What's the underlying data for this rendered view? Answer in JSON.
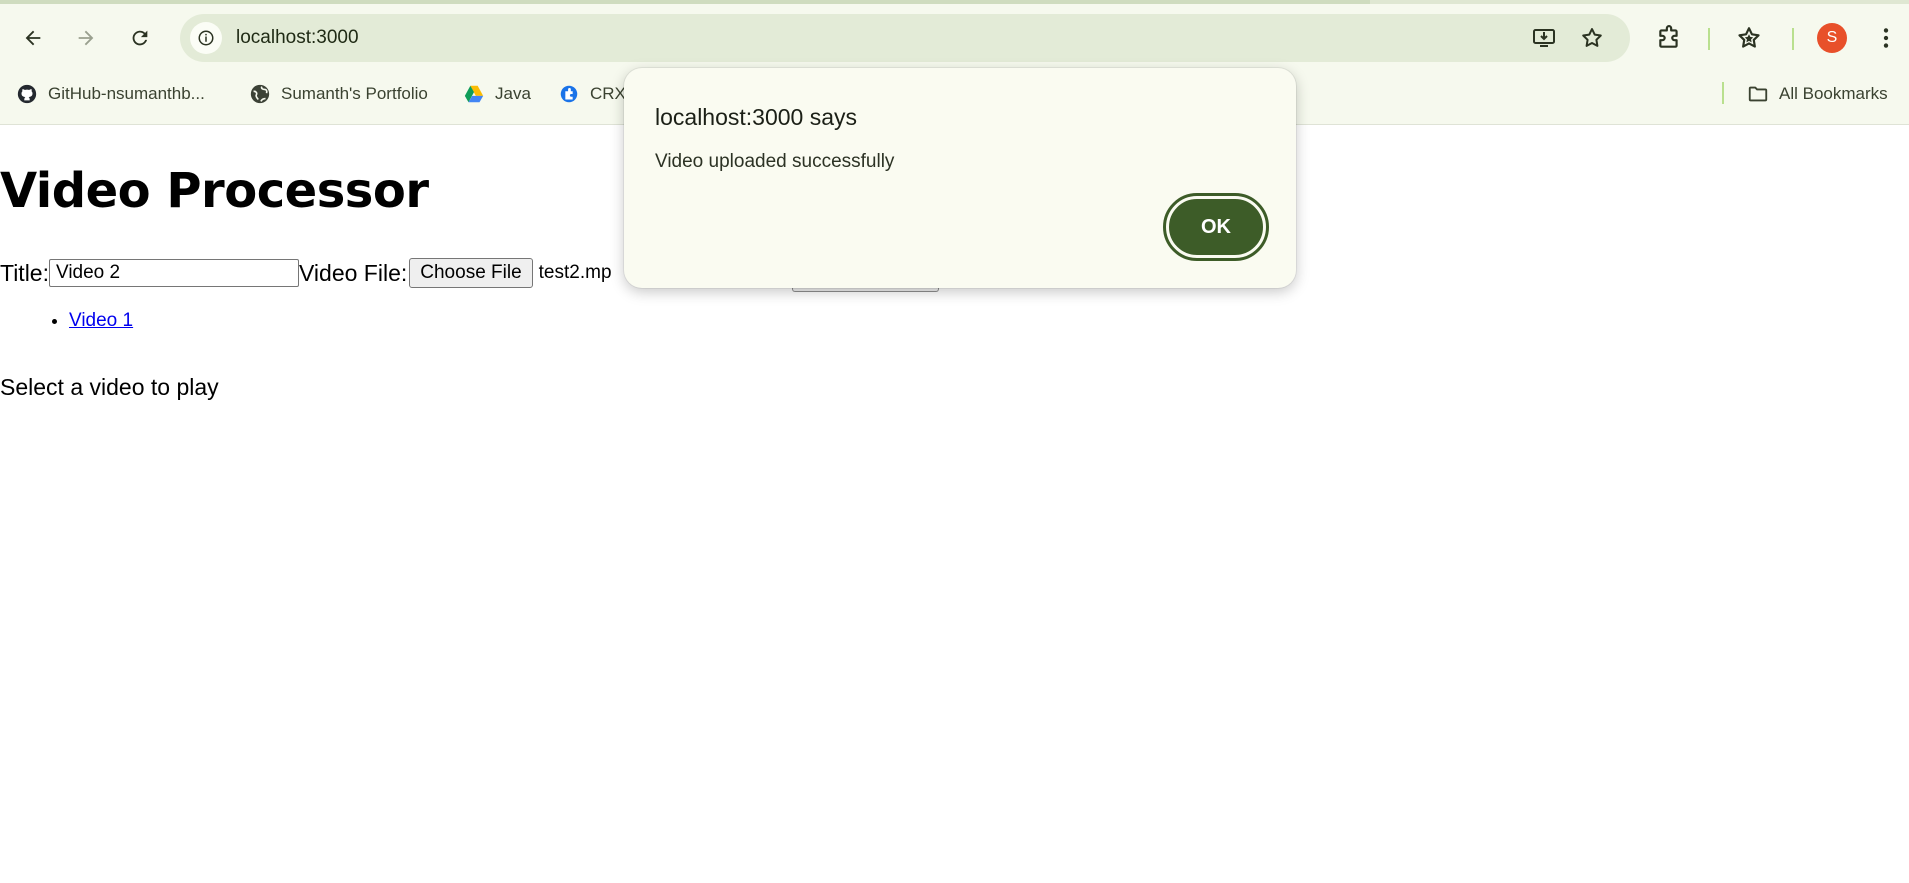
{
  "browser": {
    "url": "localhost:3000",
    "avatar_letter": "S",
    "bookmarks": [
      {
        "label": "GitHub-nsumanthb...",
        "icon": "github-icon"
      },
      {
        "label": "Sumanth's Portfolio",
        "icon": "globe-icon"
      },
      {
        "label": "Java",
        "icon": "google-drive-icon"
      },
      {
        "label": "CRX",
        "icon": "extension-puzzle-icon"
      }
    ],
    "all_bookmarks_label": "All Bookmarks"
  },
  "page": {
    "heading": "Video Processor",
    "title_label": "Title:",
    "title_value": "Video 2",
    "file_label": "Video File:",
    "choose_file_label": "Choose File",
    "file_name": "test2.mp",
    "videos": [
      "Video 1"
    ],
    "select_message": "Select a video to play"
  },
  "dialog": {
    "title": "localhost:3000 says",
    "message": "Video uploaded successfully",
    "ok_label": "OK"
  },
  "colors": {
    "chrome_bg": "#f6f9ee",
    "omnibox_bg": "#e3ebd7",
    "ok_button": "#3d5c28",
    "avatar": "#e8502a",
    "link": "#0000ee"
  }
}
